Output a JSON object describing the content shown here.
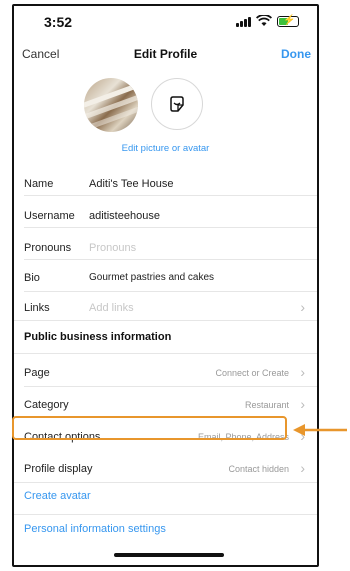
{
  "status_bar": {
    "time": "3:52"
  },
  "nav": {
    "cancel": "Cancel",
    "title": "Edit Profile",
    "done": "Done"
  },
  "profile": {
    "edit_picture_label": "Edit picture or avatar"
  },
  "fields": [
    {
      "label": "Name",
      "value": "Aditi's Tee House"
    },
    {
      "label": "Username",
      "value": "aditisteehouse"
    },
    {
      "label": "Pronouns",
      "placeholder": "Pronouns"
    },
    {
      "label": "Bio",
      "value": "Gourmet pastries and cakes"
    },
    {
      "label": "Links",
      "placeholder": "Add links"
    }
  ],
  "business": {
    "section_title": "Public business information",
    "rows": [
      {
        "label": "Page",
        "value": "Connect or Create"
      },
      {
        "label": "Category",
        "value": "Restaurant"
      },
      {
        "label": "Contact options",
        "value": "Email, Phone, Address"
      },
      {
        "label": "Profile display",
        "value": "Contact hidden"
      }
    ]
  },
  "links": {
    "create_avatar": "Create avatar",
    "personal_info": "Personal information settings"
  },
  "colors": {
    "accent": "#3797ef",
    "highlight": "#e8962c"
  },
  "icons": [
    "signal-icon",
    "wifi-icon",
    "battery-charging-icon",
    "sticker-avatar-icon",
    "chevron-right-icon",
    "arrow-left-icon"
  ]
}
